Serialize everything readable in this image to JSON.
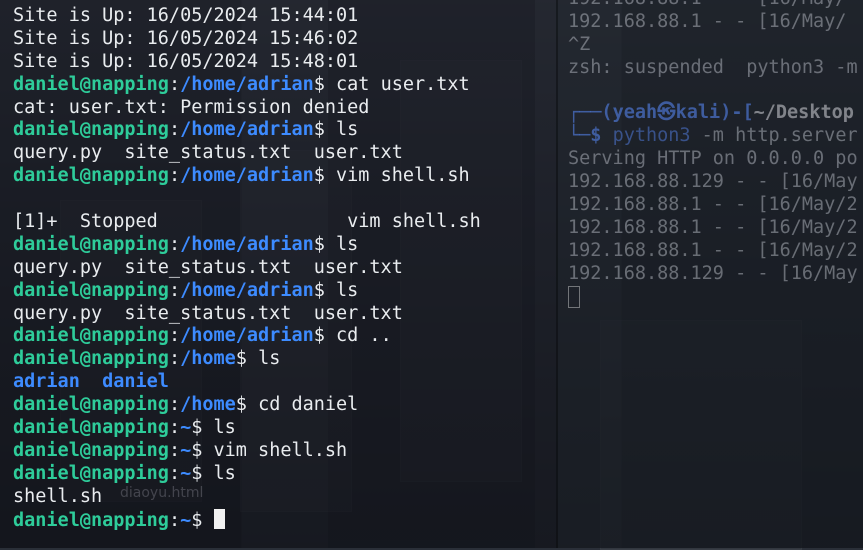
{
  "left_terminal": {
    "lines": [
      {
        "type": "out",
        "text": "Site is Up: 16/05/2024 15:44:01"
      },
      {
        "type": "out",
        "text": "Site is Up: 16/05/2024 15:46:02"
      },
      {
        "type": "out",
        "text": "Site is Up: 16/05/2024 15:48:01"
      },
      {
        "type": "prompt",
        "user": "daniel@napping",
        "path": "/home/adrian",
        "cmd": "cat user.txt"
      },
      {
        "type": "out",
        "text": "cat: user.txt: Permission denied"
      },
      {
        "type": "prompt",
        "user": "daniel@napping",
        "path": "/home/adrian",
        "cmd": "ls"
      },
      {
        "type": "out",
        "text": "query.py  site_status.txt  user.txt"
      },
      {
        "type": "prompt",
        "user": "daniel@napping",
        "path": "/home/adrian",
        "cmd": "vim shell.sh"
      },
      {
        "type": "out",
        "text": ""
      },
      {
        "type": "out",
        "text": "[1]+  Stopped                 vim shell.sh"
      },
      {
        "type": "prompt",
        "user": "daniel@napping",
        "path": "/home/adrian",
        "cmd": "ls"
      },
      {
        "type": "out",
        "text": "query.py  site_status.txt  user.txt"
      },
      {
        "type": "prompt",
        "user": "daniel@napping",
        "path": "/home/adrian",
        "cmd": "ls"
      },
      {
        "type": "out",
        "text": "query.py  site_status.txt  user.txt"
      },
      {
        "type": "prompt",
        "user": "daniel@napping",
        "path": "/home/adrian",
        "cmd": "cd .."
      },
      {
        "type": "prompt",
        "user": "daniel@napping",
        "path": "/home",
        "cmd": "ls"
      },
      {
        "type": "dirs",
        "text": "adrian  daniel"
      },
      {
        "type": "prompt",
        "user": "daniel@napping",
        "path": "/home",
        "cmd": "cd daniel"
      },
      {
        "type": "prompt",
        "user": "daniel@napping",
        "path": "~",
        "cmd": "ls"
      },
      {
        "type": "prompt",
        "user": "daniel@napping",
        "path": "~",
        "cmd": "vim shell.sh"
      },
      {
        "type": "prompt",
        "user": "daniel@napping",
        "path": "~",
        "cmd": "ls"
      },
      {
        "type": "out",
        "text": "shell.sh"
      },
      {
        "type": "prompt",
        "user": "daniel@napping",
        "path": "~",
        "cmd": "",
        "cursor": true
      }
    ]
  },
  "right_terminal": {
    "lines": [
      {
        "type": "out",
        "text": "192.168.88.1 - - [16/May/"
      },
      {
        "type": "out",
        "text": "192.168.88.1 - - [16/May/"
      },
      {
        "type": "out",
        "text": "^Z"
      },
      {
        "type": "out",
        "text": "zsh: suspended  python3 -m"
      },
      {
        "type": "out",
        "text": ""
      },
      {
        "type": "kali1",
        "user": "yeah",
        "host": "kali",
        "dir": "~/Desktop"
      },
      {
        "type": "kali2",
        "cmd": "python3",
        "rest": " -m http.server"
      },
      {
        "type": "out",
        "text": "Serving HTTP on 0.0.0.0 po"
      },
      {
        "type": "out",
        "text": "192.168.88.129 - - [16/May"
      },
      {
        "type": "out",
        "text": "192.168.88.1 - - [16/May/2"
      },
      {
        "type": "out",
        "text": "192.168.88.1 - - [16/May/2"
      },
      {
        "type": "out",
        "text": "192.168.88.1 - - [16/May/2"
      },
      {
        "type": "out",
        "text": "192.168.88.129 - - [16/May"
      },
      {
        "type": "cursor"
      }
    ]
  },
  "desktop": {
    "ghost_labels": [
      "diaoyu.html"
    ]
  }
}
